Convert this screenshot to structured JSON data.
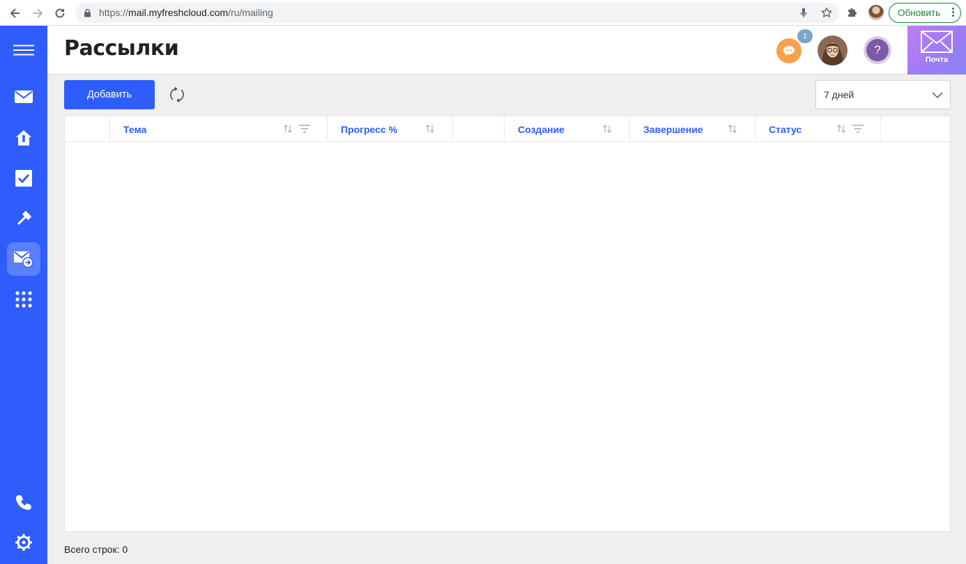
{
  "browser": {
    "url_prefix": "https://",
    "url_host": "mail.myfreshcloud.com",
    "url_path": "/ru/mailing",
    "update_label": "Обновить"
  },
  "sidebar": {
    "items": [
      {
        "icon": "menu-icon"
      },
      {
        "icon": "mail-icon"
      },
      {
        "icon": "home-icon"
      },
      {
        "icon": "tasks-icon"
      },
      {
        "icon": "gavel-icon"
      },
      {
        "icon": "mailing-icon",
        "active": true
      },
      {
        "icon": "apps-grid-icon"
      },
      {
        "icon": "phone-icon"
      },
      {
        "icon": "settings-icon"
      }
    ]
  },
  "header": {
    "title": "Рассылки",
    "chat_badge": "1",
    "help_label": "?",
    "mail_app_label": "Почта"
  },
  "toolbar": {
    "add_label": "Добавить",
    "period_value": "7 дней"
  },
  "table": {
    "columns": [
      {
        "label": ""
      },
      {
        "label": "Тема",
        "sortable": true,
        "filterable": true
      },
      {
        "label": "Прогресс %",
        "sortable": true,
        "filterable": false
      },
      {
        "label": ""
      },
      {
        "label": "Создание",
        "sortable": true,
        "filterable": false
      },
      {
        "label": "Завершение",
        "sortable": true,
        "filterable": false
      },
      {
        "label": "Статус",
        "sortable": true,
        "filterable": true
      }
    ],
    "rows": []
  },
  "footer": {
    "total_rows": "Всего строк: 0"
  },
  "colors": {
    "accent": "#2f5dfb",
    "chat": "#f7a14b",
    "help": "#7b5aa6",
    "update": "#188038"
  }
}
